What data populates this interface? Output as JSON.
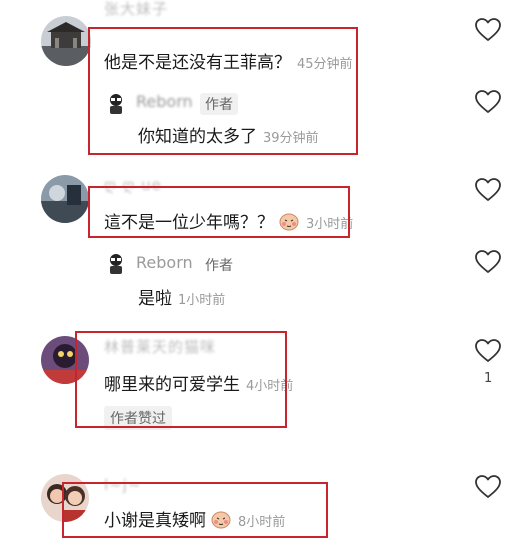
{
  "comments": [
    {
      "username": "张大妹子",
      "text": "他是不是还没有王菲高？",
      "time": "45分钟前",
      "reply": {
        "username": "Reborn",
        "author_tag": "作者",
        "text": "你知道的太多了",
        "time": "39分钟前"
      }
    },
    {
      "username": "ღ ღ ue",
      "text": "這不是一位少年嗎？？",
      "time": "3小时前",
      "reply": {
        "username": "Reborn",
        "author_tag": "作者",
        "text": "是啦",
        "time": "1小时前"
      }
    },
    {
      "username": "林普莱天的猫咪",
      "text": "哪里来的可爱学生",
      "time": "4小时前",
      "author_liked": "作者赞过",
      "like_count": "1"
    },
    {
      "username": "l~j~",
      "text": "小谢是真矮啊",
      "time": "8小时前"
    }
  ],
  "icons": {
    "like": "heart-outline-icon",
    "emoji": "shy-face-emoji-icon"
  },
  "colors": {
    "highlight_box": "#c8242d",
    "meta_text": "#9a9a9a",
    "author_tag_bg": "#f1f1f1"
  }
}
